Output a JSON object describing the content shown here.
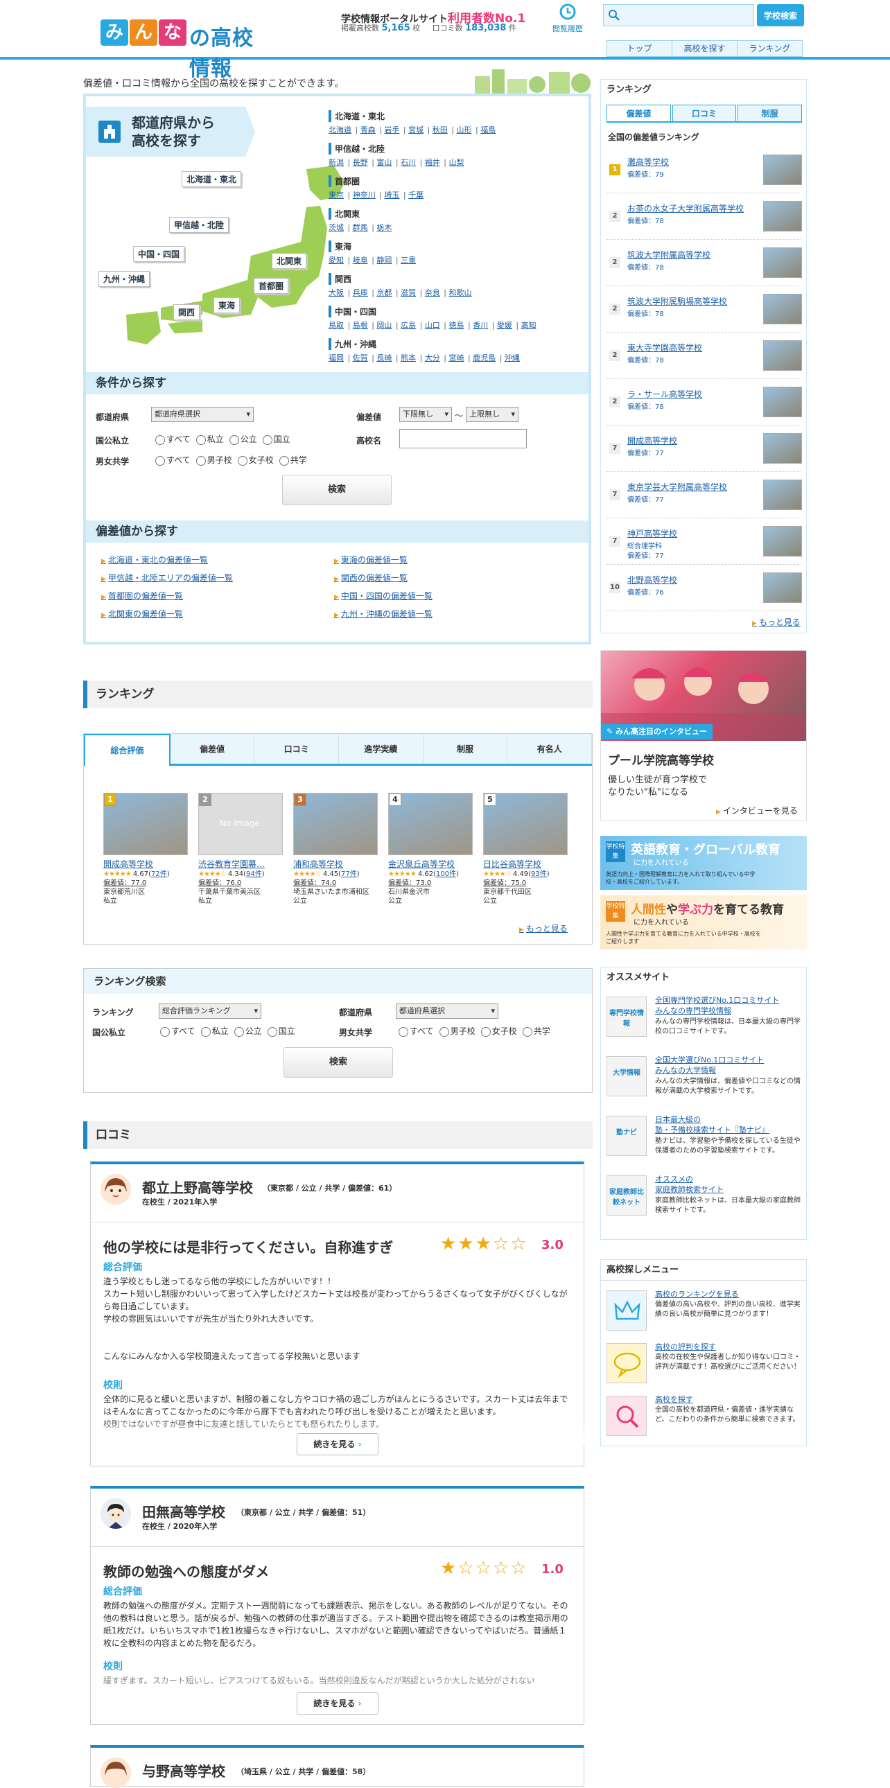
{
  "header": {
    "logo_chars": [
      "み",
      "ん",
      "な"
    ],
    "logo_suffix": "の高校情報",
    "tagline_prefix": "学校情報ポータルサイト",
    "tagline_no1": "利用者数No.1",
    "stats_label1": "掲載高校数",
    "stats_value1": "5,165",
    "stats_unit1": "校",
    "stats_label2": "口コミ数",
    "stats_value2": "183,038",
    "stats_unit2": "件",
    "history_label": "閲覧履歴",
    "search_button": "学校検索",
    "nav": [
      "トップ",
      "高校を探す",
      "ランキング"
    ]
  },
  "intro": "偏差値・口コミ情報から全国の高校を探すことができます。",
  "pref_search": {
    "title_line1": "都道府県から",
    "title_line2": "高校を探す",
    "map_tags": [
      "北海道・東北",
      "甲信越・北陸",
      "中国・四国",
      "九州・沖縄",
      "関西",
      "東海",
      "北関東",
      "首都圏"
    ],
    "regions": [
      {
        "name": "北海道・東北",
        "prefs": [
          "北海道",
          "青森",
          "岩手",
          "宮城",
          "秋田",
          "山形",
          "福島"
        ]
      },
      {
        "name": "甲信越・北陸",
        "prefs": [
          "新潟",
          "長野",
          "富山",
          "石川",
          "福井",
          "山梨"
        ]
      },
      {
        "name": "首都圏",
        "prefs": [
          "東京",
          "神奈川",
          "埼玉",
          "千葉"
        ]
      },
      {
        "name": "北関東",
        "prefs": [
          "茨城",
          "群馬",
          "栃木"
        ]
      },
      {
        "name": "東海",
        "prefs": [
          "愛知",
          "岐阜",
          "静岡",
          "三重"
        ]
      },
      {
        "name": "関西",
        "prefs": [
          "大阪",
          "兵庫",
          "京都",
          "滋賀",
          "奈良",
          "和歌山"
        ]
      },
      {
        "name": "中国・四国",
        "prefs": [
          "鳥取",
          "島根",
          "岡山",
          "広島",
          "山口",
          "徳島",
          "香川",
          "愛媛",
          "高知"
        ]
      },
      {
        "name": "九州・沖縄",
        "prefs": [
          "福岡",
          "佐賀",
          "長崎",
          "熊本",
          "大分",
          "宮崎",
          "鹿児島",
          "沖縄"
        ]
      }
    ]
  },
  "cond_search": {
    "title": "条件から探す",
    "pref_label": "都道府県",
    "pref_select": "都道府県選択",
    "dev_label": "偏差値",
    "dev_min": "下限無し",
    "dev_tilde": "～",
    "dev_max": "上限無し",
    "type_label": "国公私立",
    "type_options": [
      "すべて",
      "私立",
      "公立",
      "国立"
    ],
    "name_label": "高校名",
    "gender_label": "男女共学",
    "gender_options": [
      "すべて",
      "男子校",
      "女子校",
      "共学"
    ],
    "search_button": "検索"
  },
  "dev_search": {
    "title": "偏差値から探す",
    "links": [
      "北海道・東北の偏差値一覧",
      "東海の偏差値一覧",
      "甲信越・北陸エリアの偏差値一覧",
      "関西の偏差値一覧",
      "首都圏の偏差値一覧",
      "中国・四国の偏差値一覧",
      "北関東の偏差値一覧",
      "九州・沖縄の偏差値一覧"
    ]
  },
  "ranking": {
    "title": "ランキング",
    "tabs": [
      "総合評価",
      "偏差値",
      "口コミ",
      "進学実績",
      "制服",
      "有名人"
    ],
    "items": [
      {
        "rank": "1",
        "name": "開成高等学校",
        "score": "4.67",
        "reviews": "72件",
        "dev": "偏差値：77.0",
        "pref": "東京都荒川区",
        "type": "私立",
        "stars": "★★★★★"
      },
      {
        "rank": "2",
        "name": "渋谷教育学園幕…",
        "score": "4.34",
        "reviews": "94件",
        "dev": "偏差値：76.0",
        "pref": "千葉県千葉市美浜区",
        "type": "私立",
        "stars": "★★★★☆"
      },
      {
        "rank": "3",
        "name": "浦和高等学校",
        "score": "4.45",
        "reviews": "77件",
        "dev": "偏差値：74.0",
        "pref": "埼玉県さいたま市浦和区",
        "type": "公立",
        "stars": "★★★★☆"
      },
      {
        "rank": "4",
        "name": "金沢泉丘高等学校",
        "score": "4.62",
        "reviews": "100件",
        "dev": "偏差値：73.0",
        "pref": "石川県金沢市",
        "type": "公立",
        "stars": "★★★★★"
      },
      {
        "rank": "5",
        "name": "日比谷高等学校",
        "score": "4.49",
        "reviews": "93件",
        "dev": "偏差値：75.0",
        "pref": "東京都千代田区",
        "type": "公立",
        "stars": "★★★★☆"
      }
    ],
    "no_image": "No Image",
    "more": "もっと見る"
  },
  "rank_search": {
    "title": "ランキング検索",
    "rank_label": "ランキング",
    "rank_select": "総合評価ランキング",
    "pref_label": "都道府県",
    "pref_select": "都道府県選択",
    "type_label": "国公私立",
    "type_options": [
      "すべて",
      "私立",
      "公立",
      "国立"
    ],
    "gender_label": "男女共学",
    "gender_options": [
      "すべて",
      "男子校",
      "女子校",
      "共学"
    ],
    "search_button": "検索"
  },
  "reviews": {
    "title": "口コミ",
    "items": [
      {
        "school": "都立上野高等学校",
        "meta": "（東京都 / 公立 / 共学 / 偏差値：61）",
        "status": "在校生 / 2021年入学",
        "title": "他の学校には是非行ってください。自称進すぎ",
        "stars": "★★★☆☆",
        "score": "3.0",
        "cat1": "総合評価",
        "body1": "違う学校ともし迷ってるなら他の学校にした方がいいです！！\nスカート短いし制服かわいいって思って入学したけどスカート丈は校長が変わってからうるさくなって女子がびくびくしながら毎日過ごしています。\n学校の雰囲気はいいですが先生が当たり外れ大きいです。\n\n\nこんなにみんなか入る学校間違えたって言ってる学校無いと思います",
        "cat2": "校則",
        "body2": "全体的に見ると緩いと思いますが、制服の着こなし方やコロナ禍の過ごし方がほんとにうるさいです。スカート丈は去年まではそんなに言ってこなかったのに今年から廊下でも言われたり呼び出しを受けることが増えたと思います。\n校則ではないですが昼食中に友達と話していたらとても怒られたりします。",
        "more": "続きを見る"
      },
      {
        "school": "田無高等学校",
        "meta": "（東京都 / 公立 / 共学 / 偏差値：51）",
        "status": "在校生 / 2020年入学",
        "title": "教師の勉強への態度がダメ",
        "stars": "★☆☆☆☆",
        "score": "1.0",
        "cat1": "総合評価",
        "body1": "教師の勉強への態度がダメ。定期テスト一週間前になっても課題表示、掲示をしない。ある教師のレベルが足りてない。その他の教科は良いと思う。話が戻るが、勉強への教師の仕事が適当すぎる。テスト範囲や提出物を確認できるのは教室掲示用の紙1枚だけ。いちいちスマホで1枚1枚撮らなきゃ行けないし、スマホがないと範囲い確認できないってやばいだろ。普通紙１枚に全教科の内容まとめた物を配るだろ。",
        "cat2": "校則",
        "body2": "緩すぎます。スカート短いし、ピアスつけてる奴もいる。当然校則違反なんだが黙認というか大した処分がされない",
        "more": "続きを見る"
      },
      {
        "school": "与野高等学校",
        "meta": "（埼玉県 / 公立 / 共学 / 偏差値：58）"
      }
    ]
  },
  "side_ranking": {
    "title": "ランキング",
    "tabs": [
      "偏差値",
      "口コミ",
      "制服"
    ],
    "subtitle": "全国の偏差値ランキング",
    "items": [
      {
        "rank": "1",
        "name": "灘高等学校",
        "sub": "偏差値：79"
      },
      {
        "rank": "2",
        "name": "お茶の水女子大学附属高等学校",
        "sub": "偏差値：78"
      },
      {
        "rank": "2",
        "name": "筑波大学附属高等学校",
        "sub": "偏差値：78"
      },
      {
        "rank": "2",
        "name": "筑波大学附属駒場高等学校",
        "sub": "偏差値：78"
      },
      {
        "rank": "2",
        "name": "東大寺学園高等学校",
        "sub": "偏差値：78"
      },
      {
        "rank": "2",
        "name": "ラ・サール高等学校",
        "sub": "偏差値：78"
      },
      {
        "rank": "7",
        "name": "開成高等学校",
        "sub": "偏差値：77"
      },
      {
        "rank": "7",
        "name": "東京学芸大学附属高等学校",
        "sub": "偏差値：77"
      },
      {
        "rank": "7",
        "name": "神戸高等学校",
        "sub": "総合理学科",
        "sub2": "偏差値：77"
      },
      {
        "rank": "10",
        "name": "北野高等学校",
        "sub": "偏差値：76"
      }
    ],
    "more": "もっと見る"
  },
  "interview": {
    "tag": "みん高注目のインタビュー",
    "school": "プール学院高等学校",
    "lead1": "優しい生徒が育つ学校で",
    "lead2": "なりたい\"私\"になる",
    "more": "インタビューを見る"
  },
  "banners": [
    {
      "badge": "学校特集",
      "title": "英語教育・グローバル教育",
      "sub": "に力を入れている",
      "desc": "英語力向上・国際理解教育に力を入れて取り組んでいる中学校・高校をご紹介しています。"
    },
    {
      "badge": "学校特集",
      "title_a": "人間性",
      "title_b": "や",
      "title_c": "学ぶ力",
      "title_d": "を育てる教育",
      "sub": "に力を入れている",
      "desc": "人間性や学ぶ力を育てる教育に力を入れている中学校・高校をご紹介します"
    }
  ],
  "osusume": {
    "title": "オススメサイト",
    "items": [
      {
        "icon": "専門学校情報",
        "t1": "全国専門学校選びNo.1口コミサイト",
        "t2": "みんなの専門学校情報",
        "d": "みんなの専門学校情報は、日本最大級の専門学校の口コミサイトです。"
      },
      {
        "icon": "大学情報",
        "t1": "全国大学選びNo.1口コミサイト",
        "t2": "みんなの大学情報",
        "d": "みんなの大学情報は、偏差値や口コミなどの情報が満載の大学検索サイトです。"
      },
      {
        "icon": "塾ナビ",
        "t1": "日本最大級の",
        "t2": "塾・予備校検索サイト『塾ナビ』",
        "d": "塾ナビは、学習塾や予備校を探している生徒や保護者のための学習塾検索サイトです。"
      },
      {
        "icon": "家庭教師比較ネット",
        "t1": "オススメの",
        "t2": "家庭教師検索サイト",
        "d": "家庭教師比較ネットは、日本最大級の家庭教師検索サイトです。"
      }
    ]
  },
  "menu": {
    "title": "高校探しメニュー",
    "items": [
      {
        "link": "高校のランキングを見る",
        "d": "偏差値の高い高校や、評判の良い高校、進学実績の良い高校が簡単に見つかります！"
      },
      {
        "link": "高校の評判を探す",
        "d": "高校の在校生や保護者しか知り得ない口コミ・評判が満載です！高校選びにご活用ください！"
      },
      {
        "link": "高校を探す",
        "d": "全国の高校を都道府県・偏差値・進学実績など、こだわりの条件から簡単に検索できます。"
      }
    ]
  },
  "colors": {
    "accent": "#29a9e1",
    "brand": "#1f88c9",
    "pink": "#e63b7a",
    "star": "#f2a90c"
  }
}
